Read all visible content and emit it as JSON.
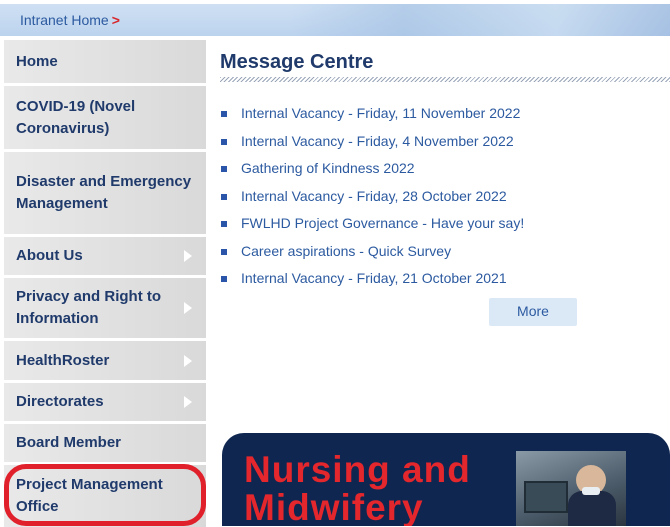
{
  "breadcrumb": {
    "home_label": "Intranet Home",
    "separator": ">"
  },
  "sidebar": {
    "items": [
      {
        "label": "Home",
        "arrow": false
      },
      {
        "label": "COVID-19 (Novel Coronavirus)",
        "arrow": false
      },
      {
        "label": "Disaster and Emergency Management",
        "arrow": false
      },
      {
        "label": "About Us",
        "arrow": true
      },
      {
        "label": "Privacy and Right to Information",
        "arrow": true
      },
      {
        "label": "HealthRoster",
        "arrow": true
      },
      {
        "label": "Directorates",
        "arrow": true
      },
      {
        "label": "Board Member",
        "arrow": false
      },
      {
        "label": "Project Management Office",
        "arrow": false
      }
    ]
  },
  "main": {
    "title": "Message Centre",
    "messages": [
      "Internal Vacancy - Friday, 11 November 2022",
      "Internal Vacancy - Friday, 4 November 2022",
      "Gathering of Kindness 2022",
      "Internal Vacancy - Friday, 28 October 2022",
      "FWLHD Project Governance - Have your say!",
      "Career aspirations - Quick Survey",
      "Internal Vacancy - Friday, 21 October 2021"
    ],
    "more_label": "More"
  },
  "banner": {
    "line1": "Nursing and",
    "line2": "Midwifery"
  },
  "colors": {
    "link": "#2c5aa0",
    "nav_text": "#1f3a6b",
    "banner_bg": "#0f2650",
    "banner_text": "#e4262d",
    "highlight": "#e0202a"
  }
}
